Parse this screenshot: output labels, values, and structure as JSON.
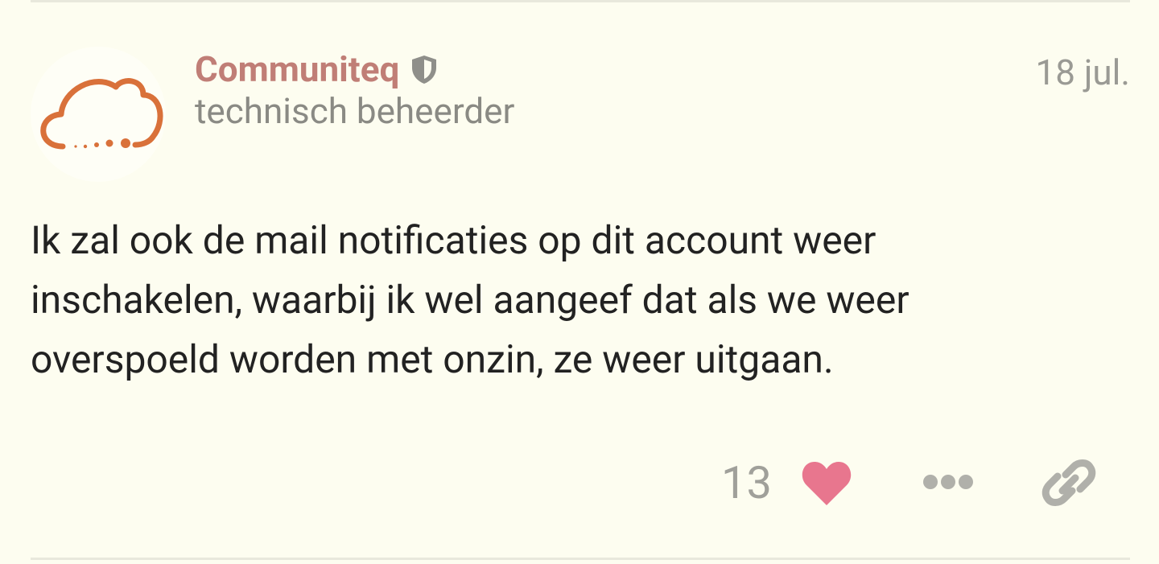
{
  "post": {
    "author": {
      "name": "Communiteq",
      "title": "technisch beheerder",
      "avatar_icon": "cloud-logo-icon",
      "badge_icon": "shield-icon"
    },
    "date": "18 jul.",
    "body": "Ik zal ook de mail notificaties op dit account weer inschakelen, waarbij ik wel aangeef dat als we weer overspoeld worden met onzin, ze weer uitgaan.",
    "actions": {
      "like_count": "13",
      "like_icon": "heart-icon",
      "more_icon": "ellipsis-icon",
      "share_icon": "link-icon"
    }
  },
  "colors": {
    "background": "#fdfdf0",
    "username": "#c07e76",
    "muted_text": "#8a8a84",
    "body_text": "#222222",
    "heart": "#e8768e",
    "icon_gray": "#b0b0aa",
    "logo_orange": "#d9713a"
  }
}
